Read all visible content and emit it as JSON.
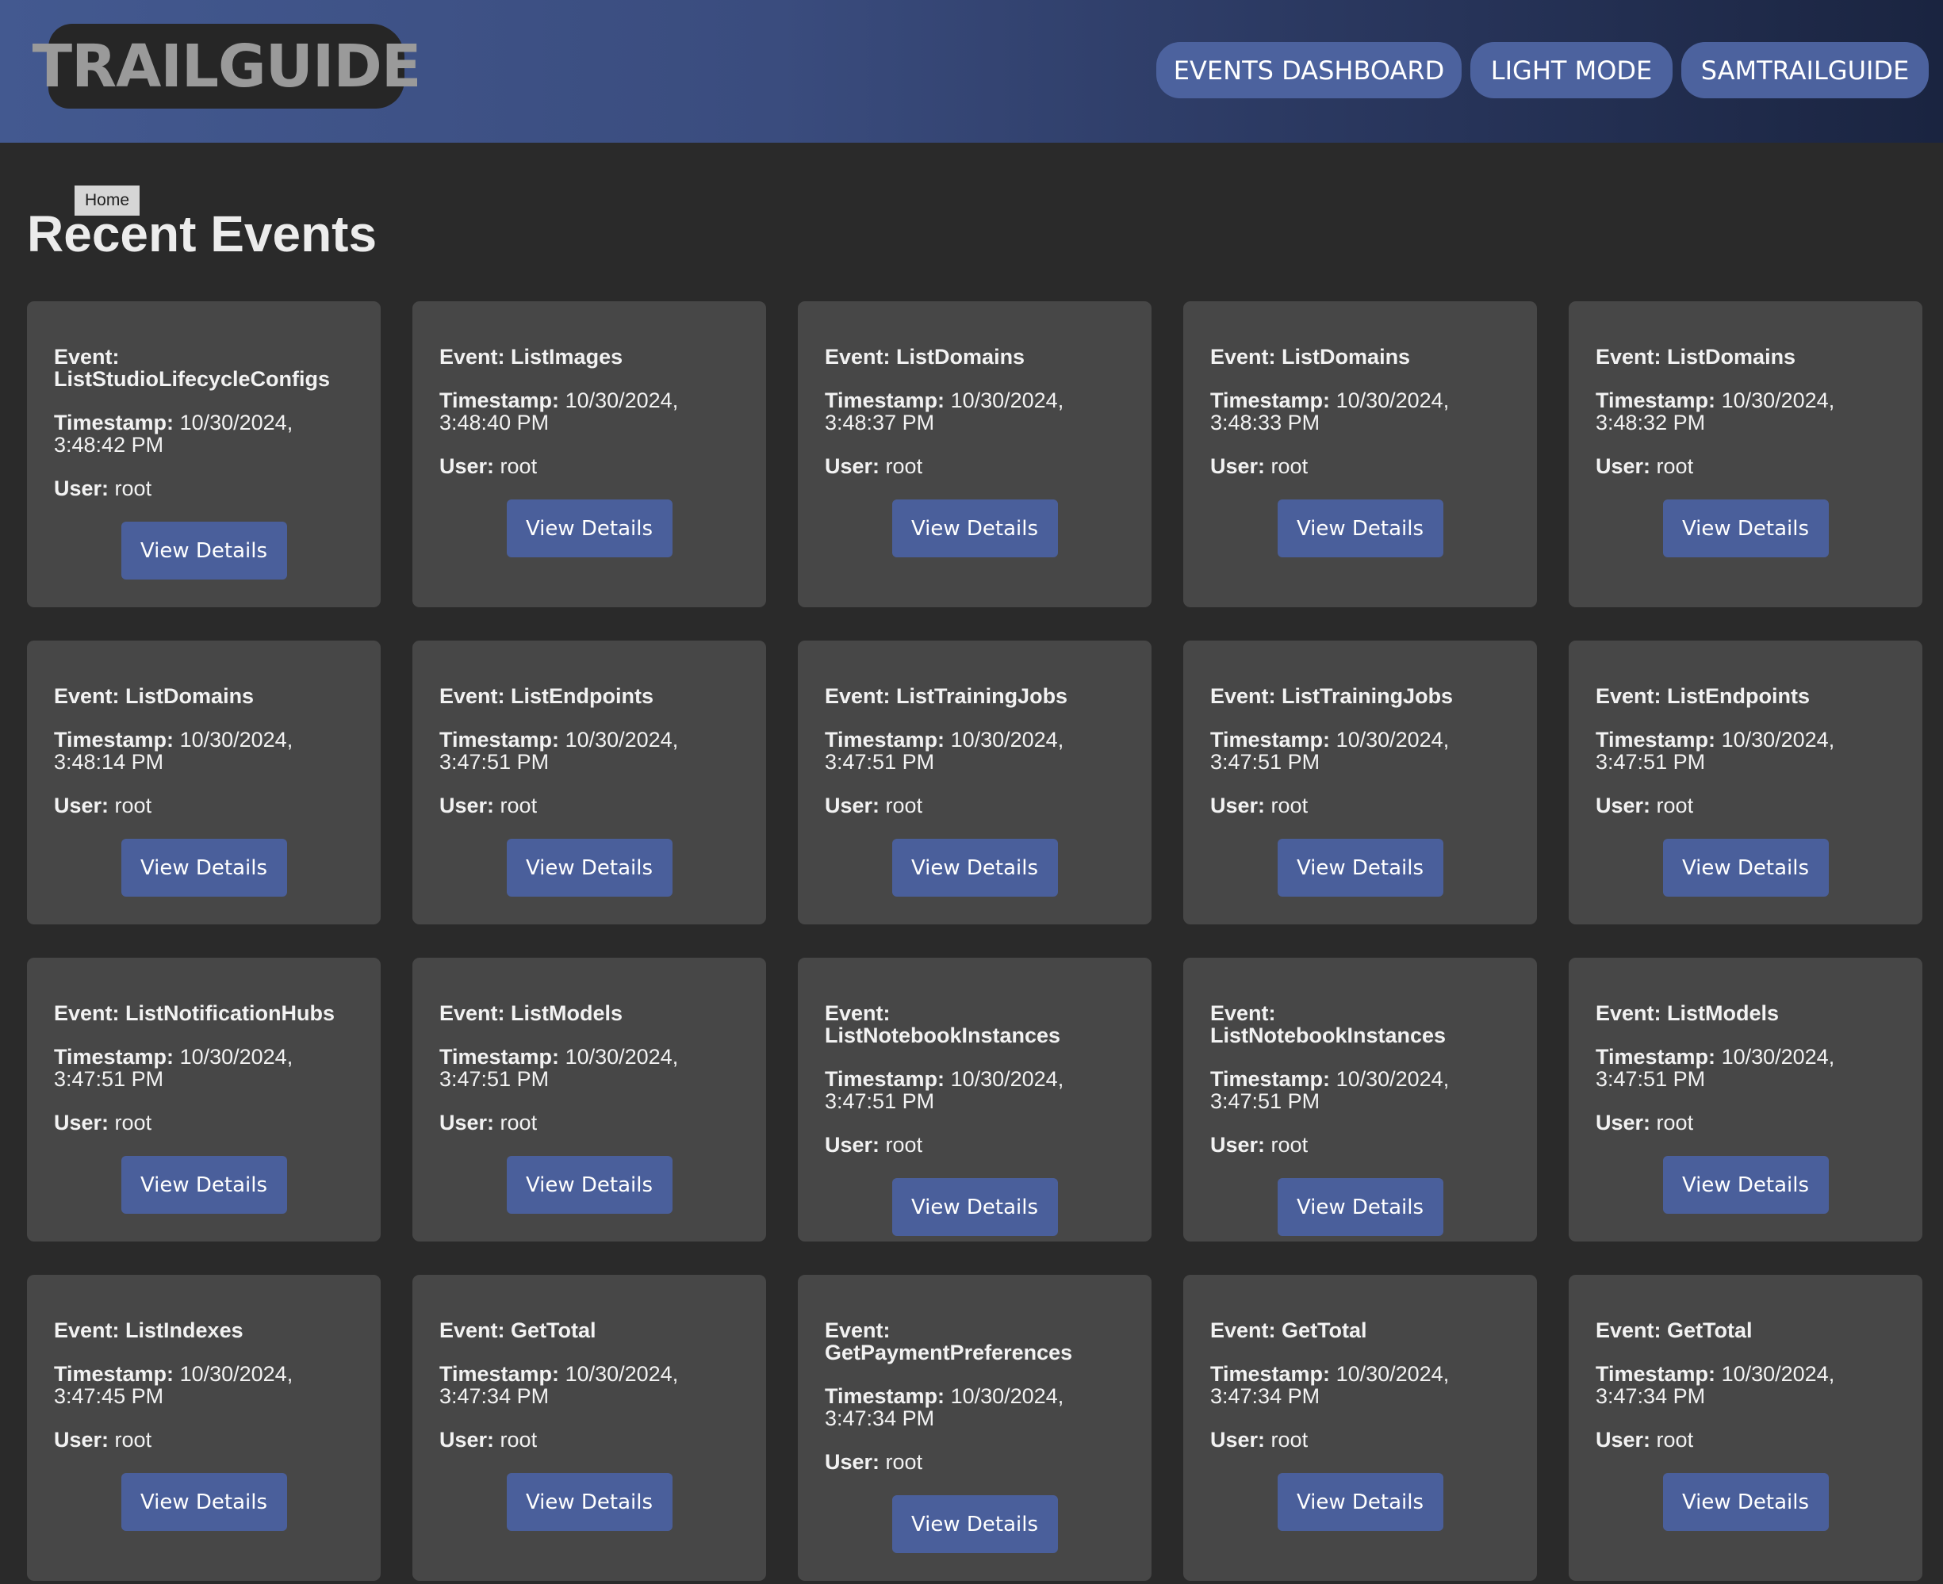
{
  "header": {
    "logo_text": "TRAILGUIDE",
    "nav": {
      "events_dashboard": "EVENTS DASHBOARD",
      "light_mode": "LIGHT MODE",
      "user": "SAMTRAILGUIDE"
    }
  },
  "breadcrumb": {
    "home": "Home"
  },
  "page": {
    "title": "Recent Events"
  },
  "labels": {
    "event": "Event:",
    "timestamp": "Timestamp:",
    "user": "User:",
    "view_details": "View Details"
  },
  "events": [
    {
      "name": "ListStudioLifecycleConfigs",
      "timestamp": "10/30/2024, 3:48:42 PM",
      "user": "root"
    },
    {
      "name": "ListImages",
      "timestamp": "10/30/2024, 3:48:40 PM",
      "user": "root"
    },
    {
      "name": "ListDomains",
      "timestamp": "10/30/2024, 3:48:37 PM",
      "user": "root"
    },
    {
      "name": "ListDomains",
      "timestamp": "10/30/2024, 3:48:33 PM",
      "user": "root"
    },
    {
      "name": "ListDomains",
      "timestamp": "10/30/2024, 3:48:32 PM",
      "user": "root"
    },
    {
      "name": "ListDomains",
      "timestamp": "10/30/2024, 3:48:14 PM",
      "user": "root"
    },
    {
      "name": "ListEndpoints",
      "timestamp": "10/30/2024, 3:47:51 PM",
      "user": "root"
    },
    {
      "name": "ListTrainingJobs",
      "timestamp": "10/30/2024, 3:47:51 PM",
      "user": "root"
    },
    {
      "name": "ListTrainingJobs",
      "timestamp": "10/30/2024, 3:47:51 PM",
      "user": "root"
    },
    {
      "name": "ListEndpoints",
      "timestamp": "10/30/2024, 3:47:51 PM",
      "user": "root"
    },
    {
      "name": "ListNotificationHubs",
      "timestamp": "10/30/2024, 3:47:51 PM",
      "user": "root"
    },
    {
      "name": "ListModels",
      "timestamp": "10/30/2024, 3:47:51 PM",
      "user": "root"
    },
    {
      "name": "ListNotebookInstances",
      "timestamp": "10/30/2024, 3:47:51 PM",
      "user": "root"
    },
    {
      "name": "ListNotebookInstances",
      "timestamp": "10/30/2024, 3:47:51 PM",
      "user": "root"
    },
    {
      "name": "ListModels",
      "timestamp": "10/30/2024, 3:47:51 PM",
      "user": "root"
    },
    {
      "name": "ListIndexes",
      "timestamp": "10/30/2024, 3:47:45 PM",
      "user": "root"
    },
    {
      "name": "GetTotal",
      "timestamp": "10/30/2024, 3:47:34 PM",
      "user": "root"
    },
    {
      "name": "GetPaymentPreferences",
      "timestamp": "10/30/2024, 3:47:34 PM",
      "user": "root"
    },
    {
      "name": "GetTotal",
      "timestamp": "10/30/2024, 3:47:34 PM",
      "user": "root"
    },
    {
      "name": "GetTotal",
      "timestamp": "10/30/2024, 3:47:34 PM",
      "user": "root"
    }
  ]
}
